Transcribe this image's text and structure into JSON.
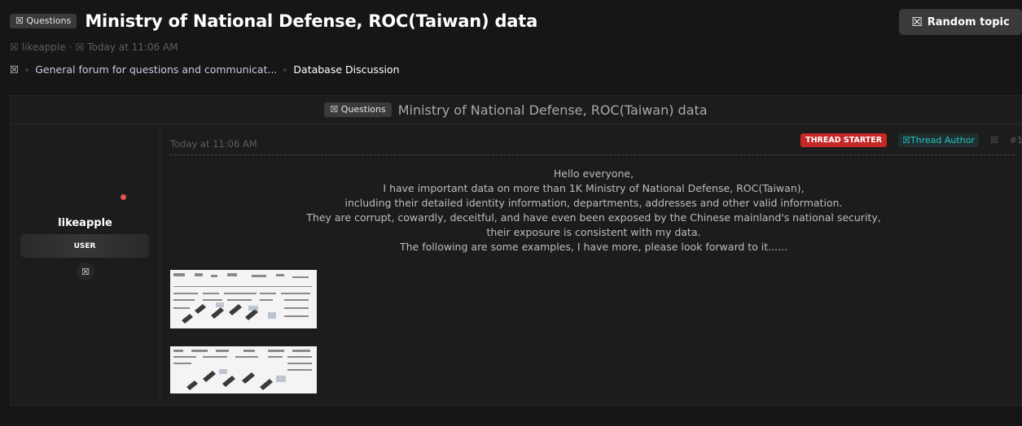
{
  "header": {
    "prefix_icon": "☒",
    "prefix_label": "Questions",
    "title": "Ministry of National Defense, ROC(Taiwan) data",
    "random_icon": "☒",
    "random_label": "Random topic",
    "author_icon": "☒",
    "author": "likeapple",
    "separator": "·",
    "time_icon": "☒",
    "time": "Today at 11:06 AM"
  },
  "breadcrumb": {
    "home_icon": "☒",
    "items": [
      "General forum for questions and communicat...",
      "Database Discussion"
    ]
  },
  "thread_box": {
    "prefix_icon": "☒",
    "prefix_label": "Questions",
    "title": "Ministry of National Defense, ROC(Taiwan) data"
  },
  "user": {
    "name": "likeapple",
    "role": "USER",
    "icon": "☒"
  },
  "post": {
    "date": "Today at 11:06 AM",
    "starter_badge": "THREAD STARTER",
    "author_badge_icon": "☒",
    "author_badge": "Thread Author",
    "share_icon": "☒",
    "number": "#1",
    "lines": [
      "Hello everyone,",
      "I have important data on more than 1K Ministry of National Defense, ROC(Taiwan),",
      "including their detailed identity information, departments, addresses and other valid information.",
      "They are corrupt, cowardly, deceitful, and have even been exposed by the Chinese mainland's national security,",
      "their exposure is consistent with my data.",
      "The following are some examples, I have more, please look forward to it......"
    ]
  },
  "colors": {
    "background": "#161616",
    "accent_red": "#c62828",
    "accent_teal": "#29c2c2",
    "online": "#e05555"
  }
}
